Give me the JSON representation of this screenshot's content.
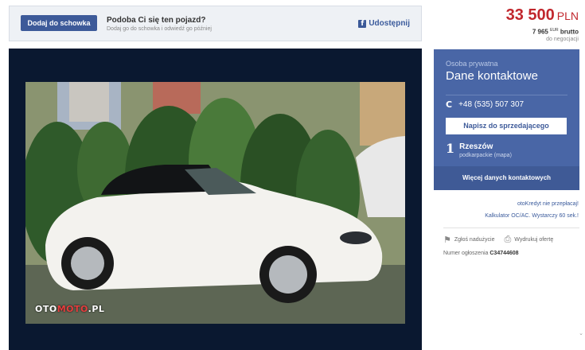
{
  "save_bar": {
    "button_label": "Dodaj do schowka",
    "title": "Podoba Ci się ten pojazd?",
    "subtitle": "Dodaj go do schowka i odwiedź go później",
    "share_icon": "facebook-icon",
    "share_label": "Udostępnij"
  },
  "price": {
    "amount": "33 500",
    "currency": "PLN",
    "eur_amount": "7 965",
    "eur_sup": "EUR",
    "eur_type": "brutto",
    "negotiable": "do negocjacji"
  },
  "gallery": {
    "watermark_a": "OTO",
    "watermark_b": "MOTO",
    "watermark_c": ".PL"
  },
  "contact": {
    "seller_type": "Osoba prywatna",
    "title": "Dane kontaktowe",
    "phone_icon": "phone-icon",
    "phone": "+48 (535) 507 307",
    "write_button": "Napisz do sprzedającego",
    "pin_icon": "location-pin-icon",
    "city": "Rzeszów",
    "region": "podkarpackie (mapa)",
    "more_button": "Więcej danych kontaktowych"
  },
  "links": {
    "credit": "otoKredyt nie przepłacaj!",
    "calculator": "Kalkulator OC/AC. Wystarczy 60 sek.!"
  },
  "actions": {
    "report_icon": "flag-icon",
    "report_label": "Zgłoś nadużycie",
    "print_icon": "printer-icon",
    "print_label": "Wydrukuj ofertę"
  },
  "ad_number": {
    "label": "Numer ogłoszenia",
    "value": "C34744608"
  },
  "colors": {
    "brand_blue": "#4966a6",
    "price_red": "#c1272d",
    "gallery_bg": "#0a1830"
  }
}
